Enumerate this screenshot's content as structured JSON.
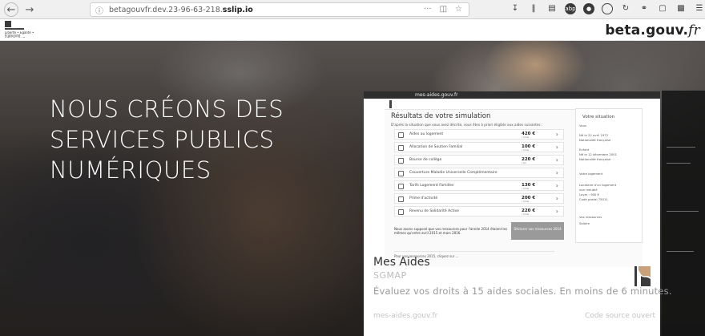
{
  "browser": {
    "url_plain": "betagouvfr.dev.23-96-63-218.",
    "url_bold": "sslip.io",
    "icons": [
      "back-arrow",
      "forward-arrow",
      "info-icon",
      "more-icon",
      "pocket-icon",
      "bookmark-star-icon",
      "download-icon",
      "library-icon",
      "sidebar-icon",
      "extension-badge-icon",
      "extension-dark-icon",
      "extension-circle-icon",
      "sync-icon",
      "link-icon",
      "screenshot-icon",
      "extension-square-icon",
      "menu-icon"
    ]
  },
  "header": {
    "logo_text": "Liberté • Égalité • Fraternité RÉPUBLIQUE FRANÇAISE",
    "brand_main": "beta.gouv.",
    "brand_tld": "fr"
  },
  "hero": {
    "title_lines": [
      "NOUS CRÉONS DES",
      "SERVICES PUBLICS",
      "NUMÉRIQUES"
    ]
  },
  "card": {
    "preview_domain": "mes-aides.gouv.fr",
    "preview": {
      "title": "Résultats de votre simulation",
      "subtitle": "D'après la situation que vous avez décrite, vous êtes à priori éligible aux aides suivantes :",
      "aides": [
        {
          "label": "Aides au logement",
          "value": "420 €",
          "unit": "/ mois"
        },
        {
          "label": "Allocation de Soutien Familial",
          "value": "100 €",
          "unit": "/ mois"
        },
        {
          "label": "Bourse de collège",
          "value": "220 €",
          "unit": "/ an"
        },
        {
          "label": "Couverture Maladie Universelle Complémentaire",
          "value": "",
          "unit": ""
        },
        {
          "label": "Tarifs Logement Familles",
          "value": "130 €",
          "unit": "/ mois"
        },
        {
          "label": "Prime d'activité",
          "value": "200 €",
          "unit": "/ mois"
        },
        {
          "label": "Revenu de Solidarité Active",
          "value": "220 €",
          "unit": "/ mois"
        }
      ],
      "note": "Nous avons supposé que vos ressources pour l'année 2014 étaient les mêmes qu'entre avril 2015 et mars 2016.",
      "recalc_button": "Déclarer vos ressources 2014",
      "more": "Pour vos ressources 2015, cliquez sur ...",
      "side": {
        "title": "Votre situation",
        "lines": [
          "Vous",
          "Né le 22 avril 1972",
          "Nationalité française",
          "Enfant",
          "Né le 12 décembre 2001",
          "Nationalité française",
          "Votre logement",
          "Locataire d'un logement",
          "non meublé",
          "Loyer : 900 €",
          "Code postal 75011",
          "Vos ressources",
          "Salaire"
        ]
      }
    },
    "title": "Mes Aides",
    "org": "SGMAP",
    "description": "Évaluez vos droits à 15 aides sociales. En moins de 6 minutes.",
    "link": "mes-aides.gouv.fr",
    "source": "Code source ouvert"
  }
}
